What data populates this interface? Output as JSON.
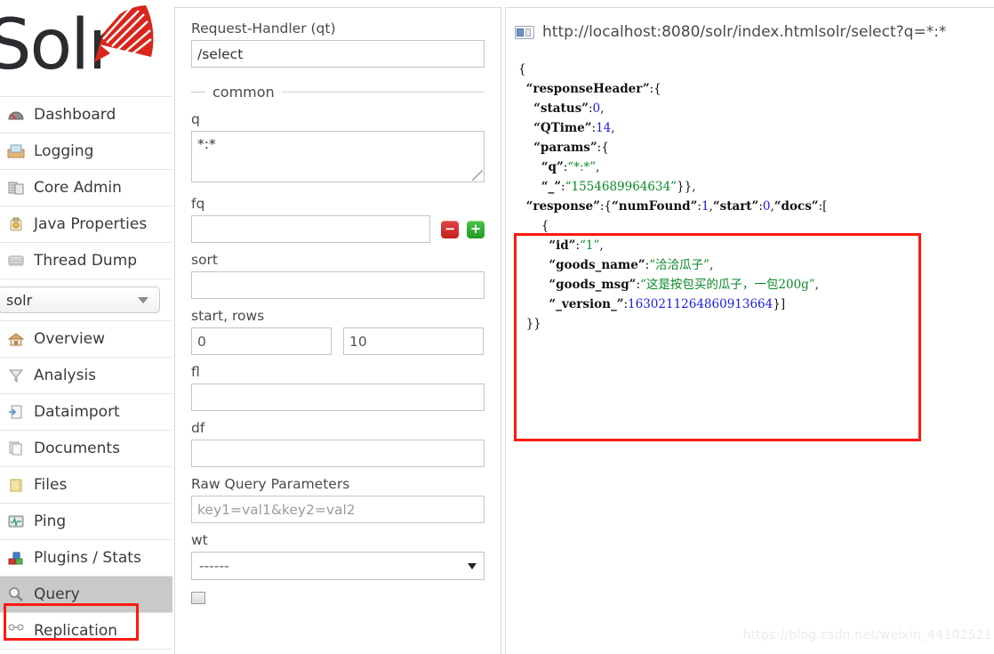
{
  "brand": {
    "name": "Solr",
    "logo_icon": "solr-sunburst-logo"
  },
  "sidebar": {
    "global_items": [
      {
        "label": "Dashboard",
        "icon": "dashboard-icon"
      },
      {
        "label": "Logging",
        "icon": "logging-icon"
      },
      {
        "label": "Core Admin",
        "icon": "core-admin-icon"
      },
      {
        "label": "Java Properties",
        "icon": "java-properties-icon"
      },
      {
        "label": "Thread Dump",
        "icon": "thread-dump-icon"
      }
    ],
    "core_selector": {
      "value": "solr",
      "caret_icon": "chevron-down-icon"
    },
    "core_items": [
      {
        "label": "Overview",
        "icon": "overview-home-icon",
        "selected": false
      },
      {
        "label": "Analysis",
        "icon": "analysis-funnel-icon",
        "selected": false
      },
      {
        "label": "Dataimport",
        "icon": "dataimport-icon",
        "selected": false
      },
      {
        "label": "Documents",
        "icon": "documents-icon",
        "selected": false
      },
      {
        "label": "Files",
        "icon": "files-folder-icon",
        "selected": false
      },
      {
        "label": "Ping",
        "icon": "ping-monitor-icon",
        "selected": false
      },
      {
        "label": "Plugins / Stats",
        "icon": "plugins-stats-icon",
        "selected": false
      },
      {
        "label": "Query",
        "icon": "query-magnifier-icon",
        "selected": true
      },
      {
        "label": "Replication",
        "icon": "replication-icon",
        "selected": false
      }
    ]
  },
  "query_form": {
    "request_handler": {
      "label": "Request-Handler (qt)",
      "value": "/select"
    },
    "section_common": "common",
    "q": {
      "label": "q",
      "value": "*:*"
    },
    "fq": {
      "label": "fq",
      "value": "",
      "minus_label": "−",
      "plus_label": "+"
    },
    "sort": {
      "label": "sort",
      "value": ""
    },
    "start_rows": {
      "label": "start, rows",
      "start": "0",
      "rows": "10"
    },
    "fl": {
      "label": "fl",
      "value": ""
    },
    "df": {
      "label": "df",
      "value": ""
    },
    "raw_query_parameters": {
      "label": "Raw Query Parameters",
      "placeholder": "key1=val1&key2=val2",
      "value": ""
    },
    "wt": {
      "label": "wt",
      "value": "------",
      "caret_icon": "chevron-down-icon"
    }
  },
  "result": {
    "url_icon": "url-page-icon",
    "url": "http://localhost:8080/solr/index.htmlsolr/select?q=*:*",
    "json_lines": [
      [
        {
          "t": "{",
          "c": "p"
        }
      ],
      [
        {
          "t": "  ",
          "c": "p"
        },
        {
          "t": "“responseHeader”",
          "c": "k"
        },
        {
          "t": ":{",
          "c": "p"
        }
      ],
      [
        {
          "t": "    ",
          "c": "p"
        },
        {
          "t": "“status”",
          "c": "k"
        },
        {
          "t": ":",
          "c": "p"
        },
        {
          "t": "0",
          "c": "num"
        },
        {
          "t": ",",
          "c": "p"
        }
      ],
      [
        {
          "t": "    ",
          "c": "p"
        },
        {
          "t": "“QTime”",
          "c": "k"
        },
        {
          "t": ":",
          "c": "p"
        },
        {
          "t": "14",
          "c": "num"
        },
        {
          "t": ",",
          "c": "p"
        }
      ],
      [
        {
          "t": "    ",
          "c": "p"
        },
        {
          "t": "“params”",
          "c": "k"
        },
        {
          "t": ":{",
          "c": "p"
        }
      ],
      [
        {
          "t": "      ",
          "c": "p"
        },
        {
          "t": "“q”",
          "c": "k"
        },
        {
          "t": ":",
          "c": "p"
        },
        {
          "t": "“*:*”",
          "c": "str"
        },
        {
          "t": ",",
          "c": "p"
        }
      ],
      [
        {
          "t": "      ",
          "c": "p"
        },
        {
          "t": "“_”",
          "c": "k"
        },
        {
          "t": ":",
          "c": "p"
        },
        {
          "t": "“1554689964634”",
          "c": "str"
        },
        {
          "t": "}},",
          "c": "p"
        }
      ],
      [
        {
          "t": "  ",
          "c": "p"
        },
        {
          "t": "“response”",
          "c": "k"
        },
        {
          "t": ":{",
          "c": "p"
        },
        {
          "t": "“numFound”",
          "c": "k"
        },
        {
          "t": ":",
          "c": "p"
        },
        {
          "t": "1",
          "c": "num"
        },
        {
          "t": ",",
          "c": "p"
        },
        {
          "t": "“start”",
          "c": "k"
        },
        {
          "t": ":",
          "c": "p"
        },
        {
          "t": "0",
          "c": "num"
        },
        {
          "t": ",",
          "c": "p"
        },
        {
          "t": "“docs”",
          "c": "k"
        },
        {
          "t": ":[",
          "c": "p"
        }
      ],
      [
        {
          "t": "      ",
          "c": "p"
        },
        {
          "t": "{",
          "c": "p"
        }
      ],
      [
        {
          "t": "        ",
          "c": "p"
        },
        {
          "t": "“id”",
          "c": "k"
        },
        {
          "t": ":",
          "c": "p"
        },
        {
          "t": "“1”",
          "c": "str"
        },
        {
          "t": ",",
          "c": "p"
        }
      ],
      [
        {
          "t": "        ",
          "c": "p"
        },
        {
          "t": "“goods_name”",
          "c": "k"
        },
        {
          "t": ":",
          "c": "p"
        },
        {
          "t": "“洽洽瓜子”",
          "c": "str"
        },
        {
          "t": ",",
          "c": "p"
        }
      ],
      [
        {
          "t": "        ",
          "c": "p"
        },
        {
          "t": "“goods_msg”",
          "c": "k"
        },
        {
          "t": ":",
          "c": "p"
        },
        {
          "t": "“这是按包买的瓜子，一包200g”",
          "c": "str"
        },
        {
          "t": ",",
          "c": "p"
        }
      ],
      [
        {
          "t": "        ",
          "c": "p"
        },
        {
          "t": "“_version_”",
          "c": "k"
        },
        {
          "t": ":",
          "c": "p"
        },
        {
          "t": "1630211264860913664",
          "c": "num"
        },
        {
          "t": "}]",
          "c": "p"
        }
      ],
      [
        {
          "t": "  }}",
          "c": "p"
        }
      ]
    ]
  },
  "annotations": {
    "response_highlight_color": "#fd1a10",
    "query_nav_highlight_color": "#fd1a10"
  },
  "watermark": "https://blog.csdn.net/weixin_44102521"
}
